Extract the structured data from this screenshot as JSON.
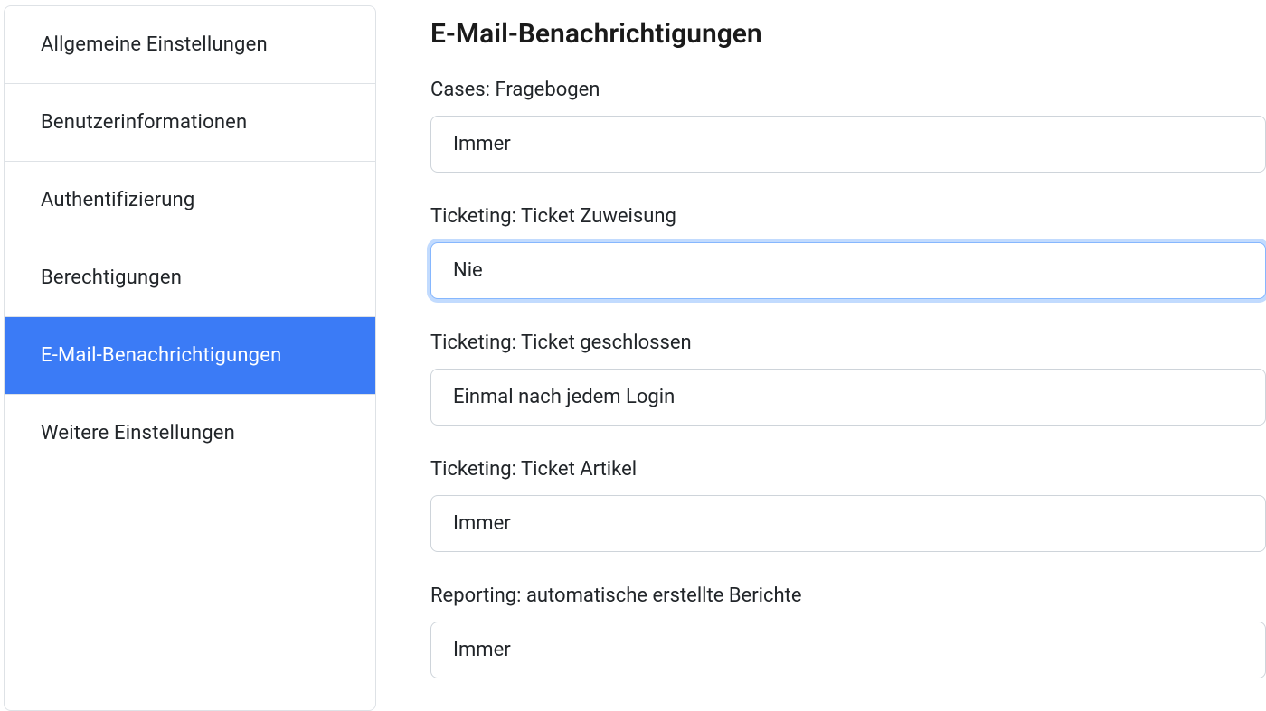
{
  "sidebar": {
    "items": [
      {
        "label": "Allgemeine Einstellungen",
        "active": false
      },
      {
        "label": "Benutzerinformationen",
        "active": false
      },
      {
        "label": "Authentifizierung",
        "active": false
      },
      {
        "label": "Berechtigungen",
        "active": false
      },
      {
        "label": "E-Mail-Benachrichtigungen",
        "active": true
      },
      {
        "label": "Weitere Einstellungen",
        "active": false
      }
    ]
  },
  "main": {
    "title": "E-Mail-Benachrichtigungen",
    "fields": [
      {
        "label": "Cases: Fragebogen",
        "value": "Immer",
        "focused": false
      },
      {
        "label": "Ticketing: Ticket Zuweisung",
        "value": "Nie",
        "focused": true
      },
      {
        "label": "Ticketing: Ticket geschlossen",
        "value": "Einmal nach jedem Login",
        "focused": false
      },
      {
        "label": "Ticketing: Ticket Artikel",
        "value": "Immer",
        "focused": false
      },
      {
        "label": "Reporting: automatische erstellte Berichte",
        "value": "Immer",
        "focused": false
      }
    ]
  }
}
